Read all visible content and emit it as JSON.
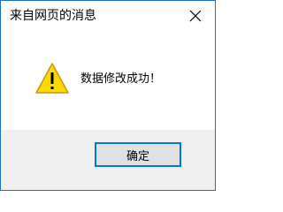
{
  "window": {
    "title": "来自网页的消息",
    "close_icon": "close-icon"
  },
  "content": {
    "icon": "warning-icon",
    "message": "数据修改成功！"
  },
  "buttons": {
    "ok_label": "确定"
  },
  "colors": {
    "border": "#1b6fc8",
    "footer_bg": "#f0f0f0",
    "button_bg": "#e1e1e1",
    "button_focus": "#0078d7",
    "warning_fill": "#ffd800",
    "warning_stroke": "#c49a00"
  }
}
